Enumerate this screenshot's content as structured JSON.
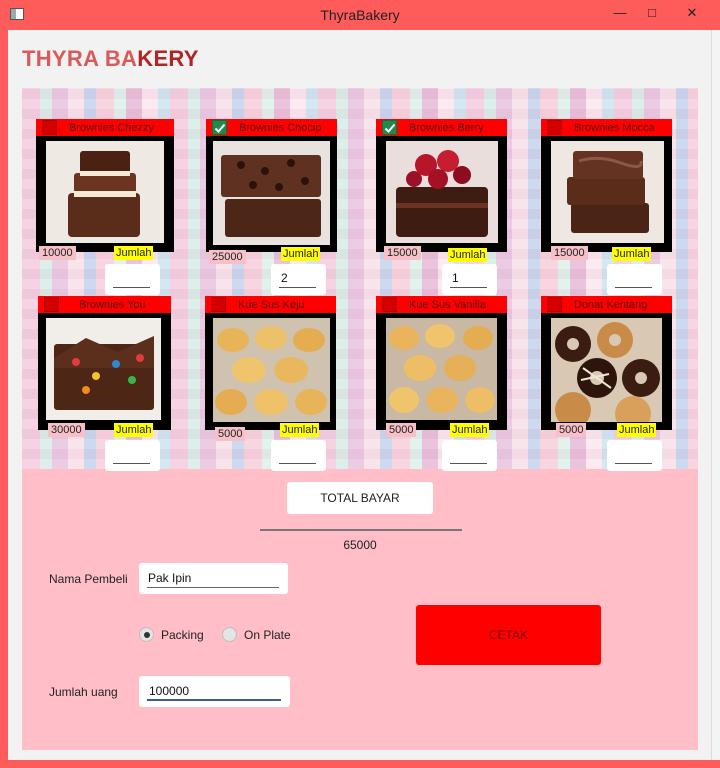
{
  "window": {
    "title": "ThyraBakery",
    "minimize": "—",
    "maximize": "□",
    "close": "✕"
  },
  "header": {
    "title_part1": "THYRA BA",
    "title_part2": "KERY"
  },
  "products": [
    {
      "name": "Brownies Chezzy",
      "price": "10000",
      "checked": false,
      "qty": "",
      "jumlah_label": "Jumlah"
    },
    {
      "name": "Brownies Chocip",
      "price": "25000",
      "checked": true,
      "qty": "2",
      "jumlah_label": "Jumlah"
    },
    {
      "name": "Brownies Berry",
      "price": "15000",
      "checked": true,
      "qty": "1",
      "jumlah_label": "Jumlah"
    },
    {
      "name": "Brownies Mocca",
      "price": "15000",
      "checked": false,
      "qty": "",
      "jumlah_label": "Jumlah"
    },
    {
      "name": "Brownies You",
      "price": "30000",
      "checked": false,
      "qty": "",
      "jumlah_label": "Jumlah"
    },
    {
      "name": "Kue Sus Keju",
      "price": "5000",
      "checked": false,
      "qty": "",
      "jumlah_label": "Jumlah"
    },
    {
      "name": "Kue Sus Vanilla",
      "price": "5000",
      "checked": false,
      "qty": "",
      "jumlah_label": "Jumlah"
    },
    {
      "name": "Donat Kentang",
      "price": "5000",
      "checked": false,
      "qty": "",
      "jumlah_label": "Jumlah"
    }
  ],
  "summary": {
    "total_button": "TOTAL BAYAR",
    "total_value": "65000"
  },
  "form": {
    "buyer_label": "Nama Pembeli",
    "buyer_value": "Pak Ipin",
    "packing_label": "Packing",
    "onplate_label": "On Plate",
    "selected_option": "Packing",
    "money_label": "Jumlah uang",
    "money_value": "100000",
    "print_button": "CETAK"
  },
  "colors": {
    "header_red": "#ff0000",
    "panel_pink": "#ffbec8",
    "jumlah_yellow": "#ffff00",
    "check_green": "#1f8a4c"
  }
}
